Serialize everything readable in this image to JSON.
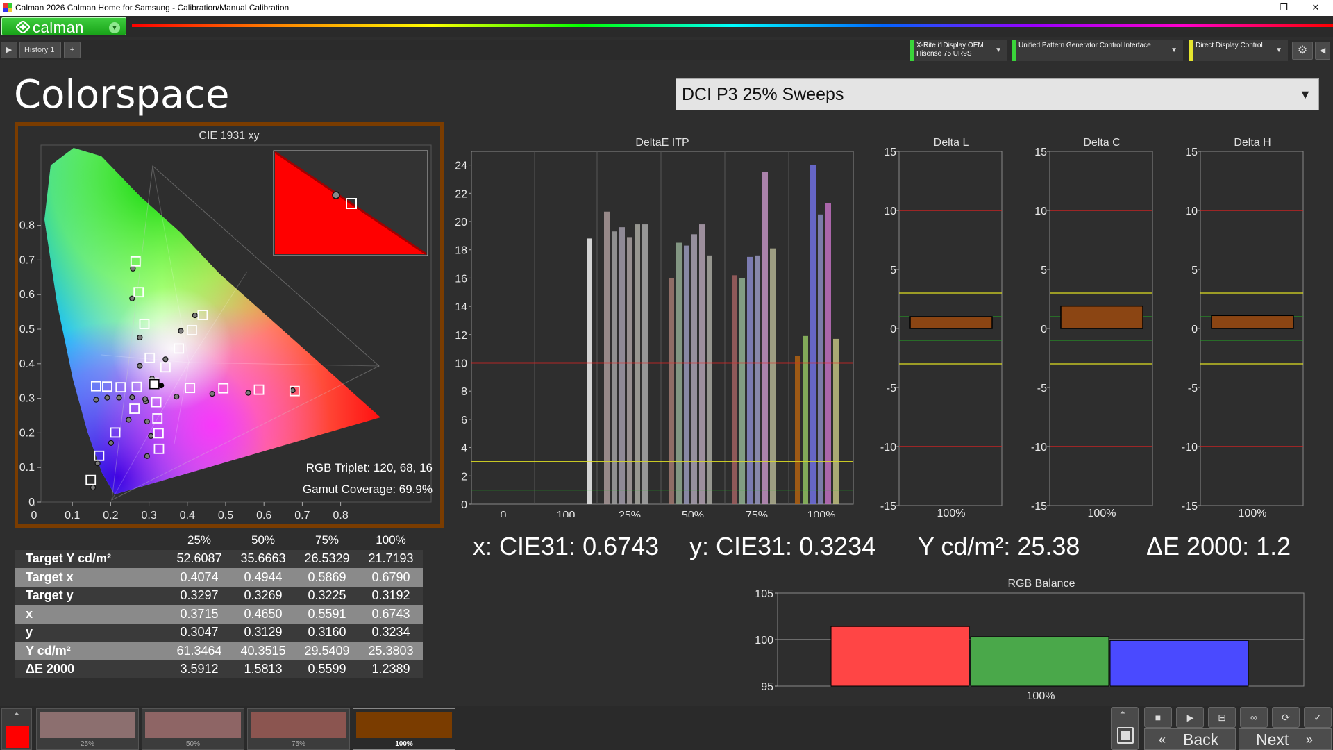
{
  "window": {
    "title": "Calman 2026 Calman Home for Samsung  - Calibration/Manual Calibration",
    "controls": [
      "minimize-icon",
      "maximize-icon",
      "close-icon"
    ]
  },
  "brand": {
    "logo_text": "calman"
  },
  "toolbar": {
    "history_tab": "History 1",
    "add_tab": "+",
    "devices": [
      {
        "line1": "X-Rite i1Display OEM",
        "line2": "Hisense 75 UR9S"
      },
      {
        "line1": "Unified Pattern Generator Control Interface",
        "line2": ""
      },
      {
        "line1": "Direct Display Control",
        "line2": ""
      }
    ]
  },
  "page": {
    "title": "Colorspace",
    "workflow": "DCI P3 25% Sweeps"
  },
  "cie": {
    "title": "CIE 1931 xy",
    "x_ticks": [
      "0",
      "0.1",
      "0.2",
      "0.3",
      "0.4",
      "0.5",
      "0.6",
      "0.7",
      "0.8"
    ],
    "y_ticks": [
      "0",
      "0.1",
      "0.2",
      "0.3",
      "0.4",
      "0.5",
      "0.6",
      "0.7",
      "0.8"
    ],
    "rgb_triplet": "RGB Triplet: 120, 68, 16",
    "gamut_coverage": "Gamut Coverage: 69.9%"
  },
  "deltae_itp": {
    "title": "DeltaE ITP",
    "y_ticks": [
      "0",
      "2",
      "4",
      "6",
      "8",
      "10",
      "12",
      "14",
      "16",
      "18",
      "20",
      "22",
      "24"
    ],
    "x_labels": [
      "0",
      "100",
      "25%",
      "50%",
      "75%",
      "100%"
    ],
    "colors": {
      "red_line": "#dd2222",
      "yellow_line": "#dddd22",
      "green_line": "#22aa22"
    }
  },
  "delta_charts": [
    {
      "title": "Delta L",
      "value": 1.0,
      "color": "#8b4513"
    },
    {
      "title": "Delta C",
      "value": 1.9,
      "color": "#8b4513"
    },
    {
      "title": "Delta H",
      "value": 1.1,
      "color": "#8b4513"
    }
  ],
  "delta_ticks": [
    "15",
    "10",
    "5",
    "0",
    "-5",
    "-10",
    "-15"
  ],
  "delta_xlabel": "100%",
  "readouts": {
    "x": "x: CIE31: 0.6743",
    "y": "y: CIE31: 0.3234",
    "Y": "Y cd/m²: 25.38",
    "de": "ΔE 2000: 1.2"
  },
  "rgb_balance": {
    "title": "RGB Balance",
    "y_ticks": [
      "105",
      "100",
      "95"
    ],
    "xlabel": "100%",
    "ylim": [
      95,
      105
    ],
    "values": {
      "r": 101.4,
      "g": 100.3,
      "b": 99.9
    },
    "colors": {
      "r": "#ff4545",
      "g": "#4aa84a",
      "b": "#4a4aff"
    }
  },
  "table": {
    "headers": [
      "",
      "25%",
      "50%",
      "75%",
      "100%"
    ],
    "rows": [
      [
        "Target Y cd/m²",
        "52.6087",
        "35.6663",
        "26.5329",
        "21.7193"
      ],
      [
        "Target x",
        "0.4074",
        "0.4944",
        "0.5869",
        "0.6790"
      ],
      [
        "Target y",
        "0.3297",
        "0.3269",
        "0.3225",
        "0.3192"
      ],
      [
        "x",
        "0.3715",
        "0.4650",
        "0.5591",
        "0.6743"
      ],
      [
        "y",
        "0.3047",
        "0.3129",
        "0.3160",
        "0.3234"
      ],
      [
        "Y cd/m²",
        "61.3464",
        "40.3515",
        "29.5409",
        "25.3803"
      ],
      [
        "ΔE 2000",
        "3.5912",
        "1.5813",
        "0.5599",
        "1.2389"
      ]
    ]
  },
  "swatches": [
    {
      "label": "25%",
      "color": "#8c6f6f"
    },
    {
      "label": "50%",
      "color": "#8e6565"
    },
    {
      "label": "75%",
      "color": "#8b5550"
    },
    {
      "label": "100%",
      "color": "#7a3c00"
    }
  ],
  "nav": {
    "back": "Back",
    "next": "Next"
  }
}
